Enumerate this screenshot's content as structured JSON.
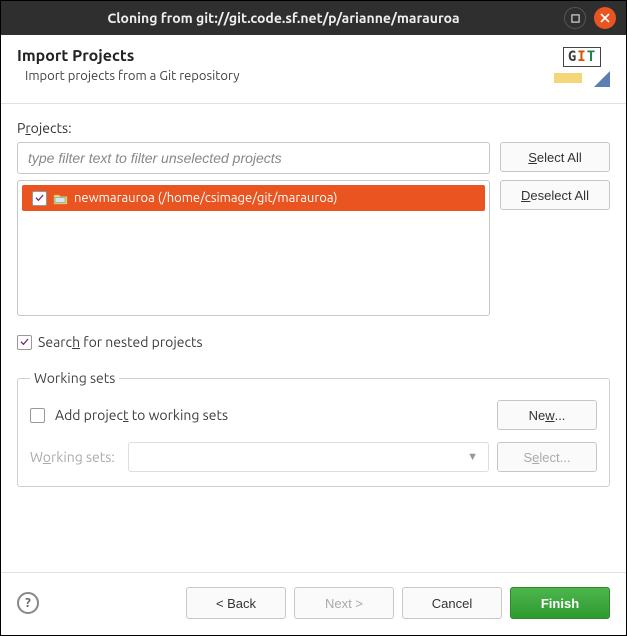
{
  "titlebar": {
    "title": "Cloning from git://git.code.sf.net/p/arianne/marauroa"
  },
  "header": {
    "title": "Import Projects",
    "subtitle": "Import projects from a Git repository",
    "badge": "GIT"
  },
  "projects": {
    "label_pre": "P",
    "label_u": "r",
    "label_post": "ojects:",
    "filter_placeholder": "type filter text to filter unselected projects",
    "items": [
      {
        "checked": true,
        "label": "newmarauroa (/home/csimage/git/marauroa)"
      }
    ],
    "select_all_pre": "",
    "select_all_u": "S",
    "select_all_post": "elect All",
    "deselect_all_pre": "",
    "deselect_all_u": "D",
    "deselect_all_post": "eselect All"
  },
  "search_nested": {
    "checked": true,
    "pre": "Searc",
    "u": "h",
    "post": " for nested projects"
  },
  "working_sets": {
    "legend": "Working sets",
    "add_checked": false,
    "add_pre": "Add projec",
    "add_u": "t",
    "add_post": " to working sets",
    "new_pre": "Ne",
    "new_u": "w",
    "new_post": "...",
    "ws_label_pre": "W",
    "ws_label_u": "o",
    "ws_label_post": "rking sets:",
    "select_pre": "S",
    "select_u": "e",
    "select_post": "lect..."
  },
  "footer": {
    "back": "< Back",
    "next": "Next >",
    "cancel": "Cancel",
    "finish": "Finish"
  }
}
